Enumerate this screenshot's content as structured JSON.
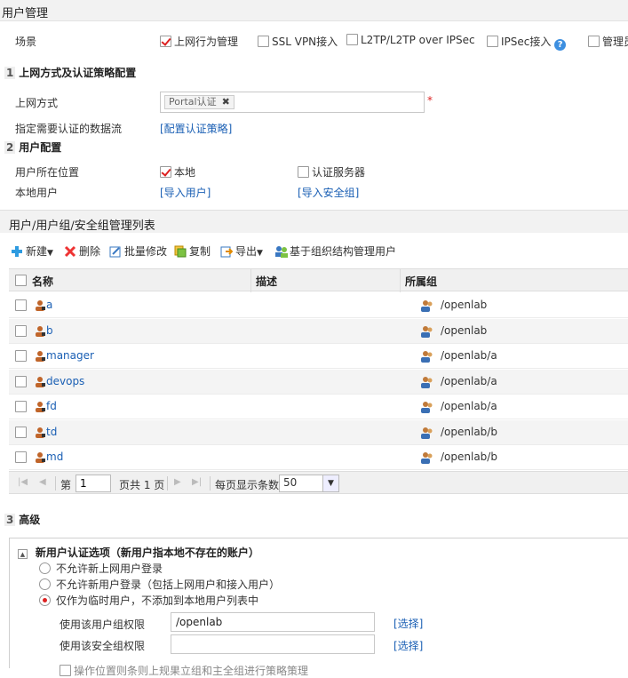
{
  "header": {
    "title": "用户管理"
  },
  "scene": {
    "label": "场景",
    "options": [
      {
        "label": "上网行为管理",
        "checked": true
      },
      {
        "label": "SSL VPN接入",
        "checked": false
      },
      {
        "label": "L2TP/L2TP over IPSec",
        "checked": false
      },
      {
        "label": "IPSec接入",
        "checked": false,
        "help": "?"
      },
      {
        "label": "管理员",
        "checked": false
      }
    ]
  },
  "section1": {
    "num": "1",
    "title": "上网方式及认证策略配置",
    "access_label": "上网方式",
    "access_tag": "Portal认证",
    "tag_remove": "✖",
    "required": "*",
    "flow_label": "指定需要认证的数据流",
    "flow_link": "[配置认证策略]"
  },
  "section2": {
    "num": "2",
    "title": "用户配置",
    "location_label": "用户所在位置",
    "location_local": "本地",
    "location_server": "认证服务器",
    "local_user_label": "本地用户",
    "import_users": "[导入用户]",
    "import_groups": "[导入安全组]"
  },
  "list_panel": {
    "title": "用户/用户组/安全组管理列表",
    "toolbar": {
      "new": "新建",
      "delete": "删除",
      "batch_edit": "批量修改",
      "copy": "复制",
      "export": "导出",
      "org_manage": "基于组织结构管理用户"
    },
    "columns": {
      "name": "名称",
      "desc": "描述",
      "group": "所属组"
    },
    "rows": [
      {
        "name": "a",
        "group": "/openlab"
      },
      {
        "name": "b",
        "group": "/openlab"
      },
      {
        "name": "manager",
        "group": "/openlab/a"
      },
      {
        "name": "devops",
        "group": "/openlab/a"
      },
      {
        "name": "fd",
        "group": "/openlab/a"
      },
      {
        "name": "td",
        "group": "/openlab/b"
      },
      {
        "name": "md",
        "group": "/openlab/b"
      }
    ],
    "pager": {
      "page_prefix": "第",
      "page_value": "1",
      "page_suffix": "页共 1 页",
      "per_page_label": "每页显示条数",
      "per_page_value": "50"
    }
  },
  "section3": {
    "num": "3",
    "title": "高级",
    "box_title": "新用户认证选项（新用户指本地不存在的账户）",
    "options": [
      {
        "label": "不允许新上网用户登录",
        "selected": false
      },
      {
        "label": "不允许新用户登录（包括上网用户和接入用户）",
        "selected": false
      },
      {
        "label": "仅作为临时用户，不添加到本地用户列表中",
        "selected": true
      }
    ],
    "group_perm_label": "使用该用户组权限",
    "group_perm_value": "/openlab",
    "sec_perm_label": "使用该安全组权限",
    "sec_perm_value": "",
    "select_link": "[选择]",
    "bottom_partial": "操作位置则条则上规果立组和主全组进行策略策理"
  },
  "colors": {
    "accent_link": "#1a5fb4",
    "check_red": "#dd2222"
  }
}
